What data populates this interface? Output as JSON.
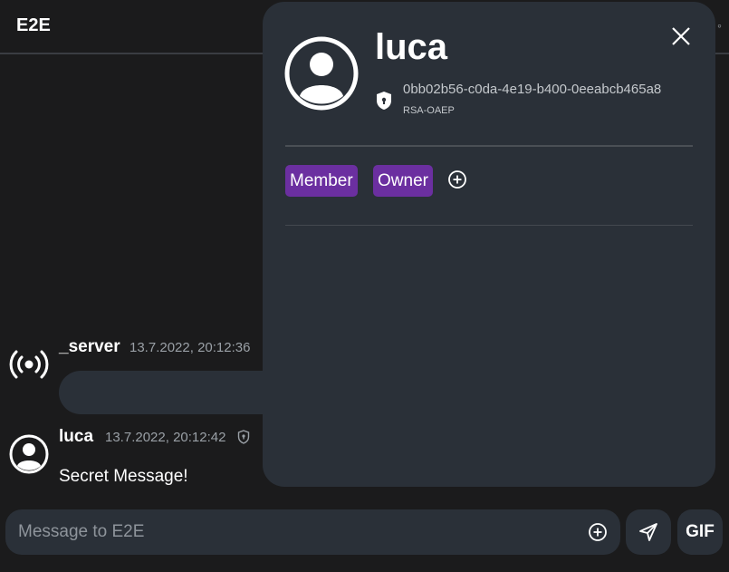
{
  "app": {
    "title": "E2E"
  },
  "messages": [
    {
      "author": "_server",
      "time": "13.7.2022, 20:12:36",
      "avatar_icon": "broadcast-icon"
    },
    {
      "author": "luca",
      "time": "13.7.2022, 20:12:42",
      "avatar_icon": "user-avatar-icon",
      "verified_icon": "shield-icon",
      "text": "Secret Message!"
    }
  ],
  "composer": {
    "placeholder": "Message to E2E",
    "send_icon": "send-icon",
    "gif_label": "GIF"
  },
  "profile_panel": {
    "name": "luca",
    "key_id": "0bb02b56-c0da-4e19-b400-0eeabcb465a8",
    "algorithm": "RSA-OAEP",
    "roles": [
      "Member",
      "Owner"
    ],
    "role_color": "#6b2fa0"
  },
  "colors": {
    "background": "#1b1b1c",
    "surface": "#2a3038",
    "text": "#ffffff",
    "muted": "#9aa0a6"
  }
}
